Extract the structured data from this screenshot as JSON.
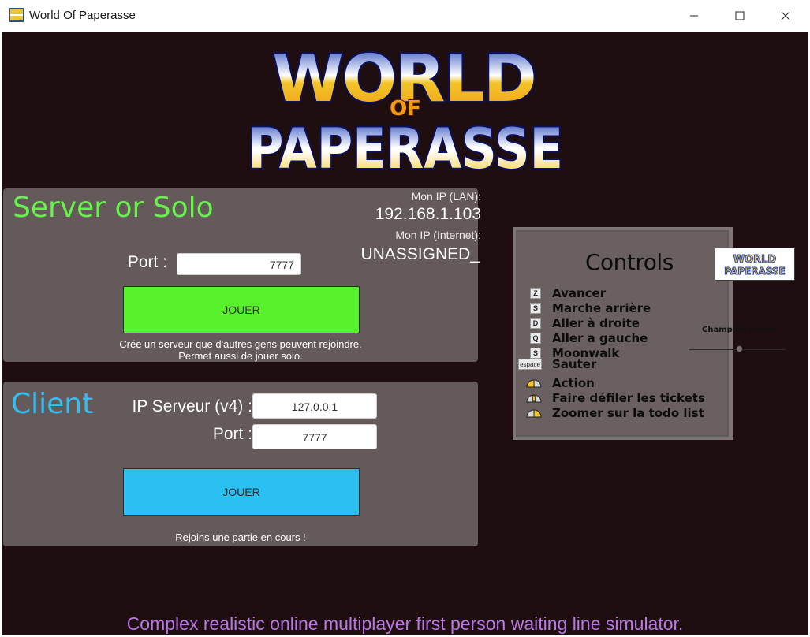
{
  "window": {
    "title": "World Of Paperasse",
    "icon": "app-logo-icon"
  },
  "logo": {
    "word1": "WORLD",
    "word2": "OF",
    "word3": "PAPERASSE"
  },
  "server": {
    "title": "Server or Solo",
    "ip_lan_label": "Mon IP  (LAN):",
    "ip_lan_value": "192.168.1.103",
    "ip_internet_label": "Mon IP (Internet):",
    "ip_internet_value": "UNASSIGNED_",
    "port_label": "Port :",
    "port_value": "7777",
    "play_label": "JOUER",
    "hint_line1": "Crée un serveur que d'autres gens peuvent rejoindre.",
    "hint_line2": "Permet aussi de jouer solo."
  },
  "client": {
    "title": "Client",
    "ip_label": "IP Serveur (v4) :",
    "ip_value": "127.0.0.1",
    "port_label": "Port :",
    "port_value": "7777",
    "play_label": "JOUER",
    "hint": "Rejoins une partie en cours !"
  },
  "controls": {
    "title": "Controls",
    "mini_logo_line1": "WORLD",
    "mini_logo_line2": "PAPERASSE",
    "items": [
      {
        "key": "Z",
        "label": "Avancer"
      },
      {
        "key": "S",
        "label": "Marche arrière"
      },
      {
        "key": "D",
        "label": "Aller à droite"
      },
      {
        "key": "Q",
        "label": "Aller a gauche"
      },
      {
        "key": "S",
        "label": "Moonwalk"
      },
      {
        "key": "espace",
        "label": "Sauter"
      },
      {
        "key": "mouse-left",
        "label": "Action"
      },
      {
        "key": "mouse-wheel",
        "label": "Faire défiler les tickets"
      },
      {
        "key": "mouse-right",
        "label": "Zoomer sur la todo list"
      }
    ],
    "fov_label": "Champ de vision",
    "fov_value": 0.52
  },
  "tagline": "Complex realistic online multiplayer first person waiting line simulator.",
  "colors": {
    "background": "#1f0e0f",
    "panel": "#655a5a",
    "server_green": "#58f22c",
    "client_blue": "#2bc0f2",
    "tagline_purple": "#b877e5"
  }
}
